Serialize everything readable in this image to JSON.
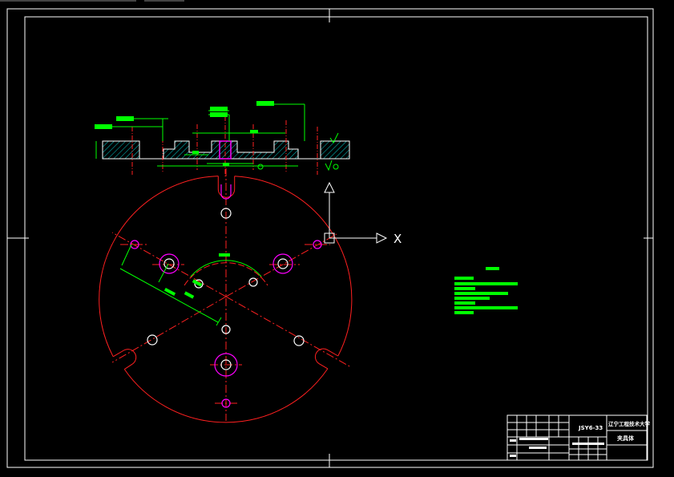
{
  "colors": {
    "background": "#000000",
    "frame": "#ffffff",
    "part_outline": "#ff2020",
    "dimension": "#00ff00",
    "hole_highlight": "#ff00ff",
    "hatch": "#00ffff",
    "hole": "#ffffff",
    "axis": "#ffffff"
  },
  "ucs": {
    "x_label": "X"
  },
  "title_block": {
    "drawing_no": "JSY6-33",
    "school": "辽宁工程技术大学",
    "part_name": "夹具体"
  },
  "icons": [
    "ucs-axis-icon",
    "surface-roughness-icon"
  ]
}
